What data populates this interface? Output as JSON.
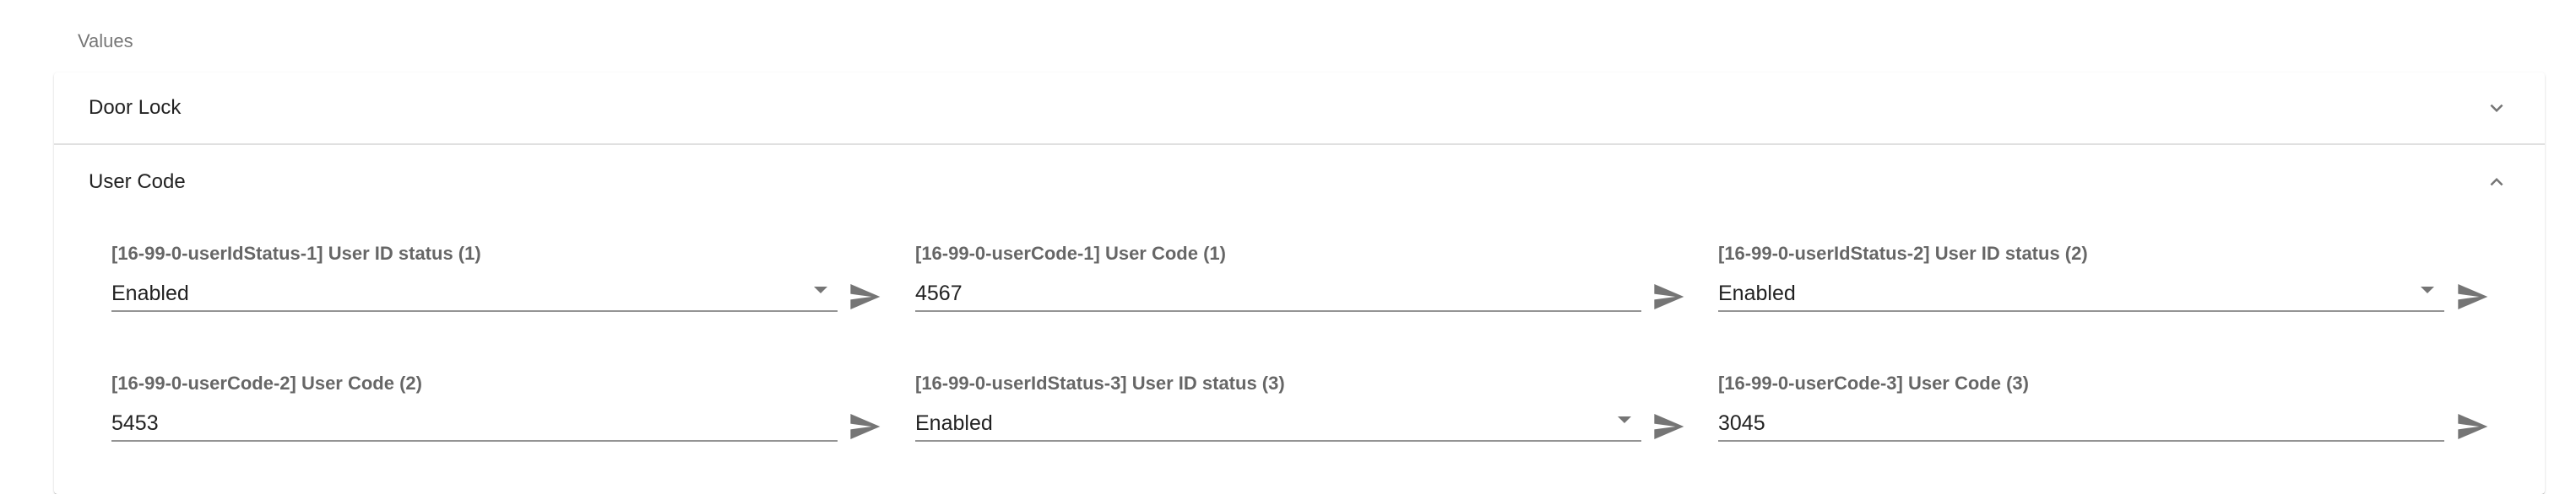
{
  "section": {
    "label": "Values"
  },
  "panels": [
    {
      "title": "Door Lock",
      "expanded": false,
      "chevron_icon": "chevron-down-icon"
    },
    {
      "title": "User Code",
      "expanded": true,
      "chevron_icon": "chevron-up-icon"
    }
  ],
  "fields": [
    {
      "label": "[16-99-0-userIdStatus-1] User ID status (1)",
      "value": "Enabled",
      "type": "select"
    },
    {
      "label": "[16-99-0-userCode-1] User Code (1)",
      "value": "4567",
      "type": "text"
    },
    {
      "label": "[16-99-0-userIdStatus-2] User ID status (2)",
      "value": "Enabled",
      "type": "select"
    },
    {
      "label": "[16-99-0-userCode-2] User Code (2)",
      "value": "5453",
      "type": "text"
    },
    {
      "label": "[16-99-0-userIdStatus-3] User ID status (3)",
      "value": "Enabled",
      "type": "select"
    },
    {
      "label": "[16-99-0-userCode-3] User Code (3)",
      "value": "3045",
      "type": "text"
    }
  ],
  "icons": {
    "send": "send-icon",
    "dropdown": "dropdown-arrow-icon"
  },
  "colors": {
    "icon": "#757575",
    "divider": "#e0e0e0",
    "underline": "#9e9e9e"
  }
}
